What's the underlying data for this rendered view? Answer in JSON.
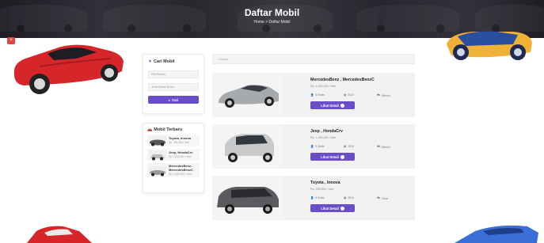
{
  "hero": {
    "title": "Daftar Mobil",
    "breadcrumb": "Home > Daftar Mobil"
  },
  "badge": {
    "icon": "close-icon",
    "glyph": "×"
  },
  "search_panel": {
    "title": "Cari Mobil",
    "brand_select": "Pilih Merek",
    "price_select": "Jenis Batas Bulan",
    "button_label": "Cari"
  },
  "new_cars_panel": {
    "title": "Mobil Terbaru",
    "items": [
      {
        "name": "Toyota, Innova",
        "price": "Rp. 325,000 / Hari"
      },
      {
        "name": "Jeep, HondaCrv",
        "price": "Rp. 1,000,000 / Hari"
      },
      {
        "name": "MercedesBenz, MercedesBenzC",
        "price": "Rp. 1,000,000 / Hari"
      }
    ]
  },
  "sort_bar": {
    "value": "Urutan"
  },
  "cars": [
    {
      "name": "MercedesBenz , MercedesBenzC",
      "price": "Rp. 1,000,000 / Hari",
      "seats": "5 Seats",
      "year": "2010",
      "fuel": "Bensin",
      "button": "Lihat Detail",
      "color": "#a7aaad"
    },
    {
      "name": "Jeep , HondaCrv",
      "price": "Rp. 1,000,000 / Hari",
      "seats": "5 Seats",
      "year": "2015",
      "fuel": "Bensin",
      "button": "Lihat Detail",
      "color": "#c8c9cb"
    },
    {
      "name": "Toyota , Innova",
      "price": "Rp. 325,000 / Hari",
      "seats": "8 Seats",
      "year": "2010",
      "fuel": "Solar",
      "button": "Lihat Detail",
      "color": "#5a5b5e"
    }
  ],
  "colors": {
    "accent": "#6a4ec8",
    "badge": "#e04548",
    "hero": "#3b3640"
  }
}
